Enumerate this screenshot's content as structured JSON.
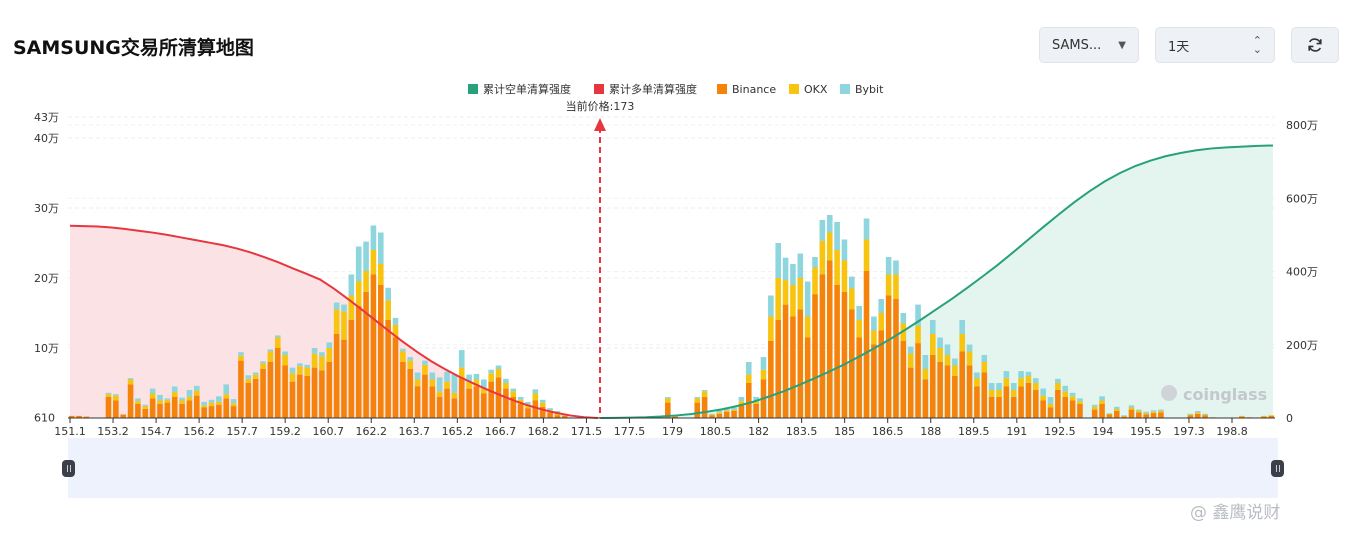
{
  "page": {
    "title": "SAMSUNG交易所清算地图",
    "symbol_select": "SAMS...",
    "range_select": "1天",
    "watermark_logo": "coinglass",
    "watermark_credit": "@ 鑫鹰说财"
  },
  "colors": {
    "short_cum": "#26a17b",
    "long_cum": "#e8363f",
    "binance": "#f5820a",
    "okx": "#f7c510",
    "bybit": "#8dd6dd",
    "long_fill": "#fbe3e5",
    "short_fill": "#e4f5ef"
  },
  "chart_data": {
    "type": "bar",
    "current_price_label": "当前价格:173",
    "current_price": 173,
    "legend": [
      "累计空单清算强度",
      "累计多单清算强度",
      "Binance",
      "OKX",
      "Bybit"
    ],
    "x_tick_labels": [
      "151.1",
      "153.2",
      "154.7",
      "156.2",
      "157.7",
      "159.2",
      "160.7",
      "162.2",
      "163.7",
      "165.2",
      "166.7",
      "168.2",
      "171.5",
      "177.5",
      "179",
      "180.5",
      "182",
      "183.5",
      "185",
      "186.5",
      "188",
      "189.5",
      "191",
      "192.5",
      "194",
      "195.5",
      "197.3",
      "198.8"
    ],
    "y_left_ticks": [
      {
        "value": 610,
        "label": "610"
      },
      {
        "value": 100000,
        "label": "10万"
      },
      {
        "value": 200000,
        "label": "20万"
      },
      {
        "value": 300000,
        "label": "30万"
      },
      {
        "value": 400000,
        "label": "40万"
      },
      {
        "value": 430000,
        "label": "43万"
      }
    ],
    "y_right_ticks": [
      {
        "value": 0,
        "label": "0"
      },
      {
        "value": 2000000,
        "label": "200万"
      },
      {
        "value": 4000000,
        "label": "400万"
      },
      {
        "value": 6000000,
        "label": "600万"
      },
      {
        "value": 8000000,
        "label": "800万"
      }
    ],
    "ylim_left": [
      0,
      430000
    ],
    "ylim_right": [
      0,
      8000000
    ],
    "bars_binance": [
      3000,
      3000,
      2000,
      0,
      0,
      30000,
      25000,
      5000,
      48000,
      20000,
      13000,
      28000,
      20000,
      22000,
      30000,
      20000,
      25000,
      32000,
      15000,
      17000,
      19000,
      28000,
      17000,
      82000,
      50000,
      56000,
      70000,
      80000,
      100000,
      75000,
      52000,
      62000,
      60000,
      72000,
      68000,
      80000,
      120000,
      112000,
      140000,
      160000,
      180000,
      205000,
      190000,
      140000,
      115000,
      80000,
      70000,
      45000,
      62000,
      45000,
      30000,
      42000,
      28000,
      58000,
      42000,
      45000,
      35000,
      52000,
      58000,
      42000,
      30000,
      20000,
      14000,
      25000,
      16000,
      8000,
      4000,
      3000,
      0,
      0,
      0,
      0,
      0,
      0,
      0,
      0,
      0,
      0,
      0,
      0,
      0,
      22000,
      2000,
      0,
      0,
      22000,
      30000,
      4000,
      6000,
      9000,
      10000,
      20000,
      50000,
      20000,
      55000,
      110000,
      140000,
      162000,
      145000,
      155000,
      115000,
      177000,
      205000,
      225000,
      190000,
      180000,
      155000,
      115000,
      210000,
      105000,
      125000,
      175000,
      170000,
      110000,
      72000,
      107000,
      55000,
      90000,
      80000,
      75000,
      60000,
      95000,
      75000,
      45000,
      65000,
      30000,
      30000,
      45000,
      30000,
      45000,
      50000,
      40000,
      25000,
      15000,
      40000,
      30000,
      25000,
      20000,
      0,
      12000,
      20000,
      5000,
      10000,
      2000,
      12000,
      8000,
      5000,
      7000,
      8000,
      0,
      0,
      0,
      4000,
      6000,
      4000,
      1000,
      0,
      0,
      0,
      2000,
      1000,
      0,
      2000,
      3000
    ],
    "bars_okx": [
      0,
      0,
      0,
      0,
      0,
      4000,
      7000,
      0,
      7000,
      4000,
      4000,
      7000,
      5000,
      4000,
      7000,
      5000,
      5000,
      7000,
      3000,
      5000,
      4000,
      6000,
      4000,
      7000,
      6000,
      6000,
      8000,
      15000,
      15000,
      15000,
      12000,
      12000,
      12000,
      20000,
      20000,
      20000,
      35000,
      40000,
      35000,
      35000,
      30000,
      35000,
      30000,
      28000,
      18000,
      15000,
      12000,
      10000,
      14000,
      10000,
      8000,
      10000,
      8000,
      14000,
      10000,
      10000,
      8000,
      12000,
      12000,
      8000,
      8000,
      6000,
      5000,
      10000,
      6000,
      3000,
      2000,
      1000,
      0,
      0,
      0,
      0,
      0,
      0,
      0,
      0,
      0,
      0,
      0,
      0,
      0,
      6000,
      1000,
      0,
      0,
      6000,
      8000,
      1000,
      2000,
      2000,
      2000,
      4000,
      12000,
      4000,
      14000,
      35000,
      60000,
      35000,
      45000,
      45000,
      30000,
      38000,
      48000,
      40000,
      50000,
      45000,
      30000,
      25000,
      45000,
      20000,
      25000,
      30000,
      35000,
      25000,
      20000,
      25000,
      15000,
      30000,
      20000,
      15000,
      15000,
      25000,
      20000,
      12000,
      15000,
      10000,
      10000,
      12000,
      10000,
      12000,
      10000,
      10000,
      7000,
      5000,
      10000,
      8000,
      6000,
      4000,
      0,
      4000,
      5000,
      1000,
      3000,
      1000,
      3000,
      2000,
      2000,
      2000,
      2000,
      0,
      0,
      0,
      1000,
      2000,
      1000,
      0,
      0,
      0,
      0,
      1000,
      0,
      0,
      1000,
      1000
    ],
    "bars_bybit": [
      0,
      0,
      0,
      0,
      0,
      2000,
      2000,
      0,
      2000,
      4000,
      2000,
      7000,
      8000,
      2000,
      8000,
      4000,
      10000,
      7000,
      5000,
      4000,
      8000,
      14000,
      6000,
      5000,
      5000,
      3000,
      3000,
      3000,
      3000,
      5000,
      8000,
      4000,
      4000,
      8000,
      6000,
      8000,
      10000,
      10000,
      30000,
      50000,
      42000,
      35000,
      45000,
      18000,
      10000,
      4000,
      5000,
      10000,
      6000,
      10000,
      20000,
      14000,
      26000,
      25000,
      10000,
      8000,
      12000,
      5000,
      5000,
      6000,
      4000,
      4000,
      4000,
      6000,
      4000,
      3000,
      4000,
      2000,
      0,
      0,
      0,
      0,
      0,
      0,
      0,
      0,
      0,
      0,
      0,
      0,
      0,
      2000,
      1000,
      0,
      0,
      2000,
      2000,
      1000,
      3000,
      4000,
      3000,
      6000,
      18000,
      6000,
      18000,
      30000,
      50000,
      32000,
      30000,
      35000,
      50000,
      15000,
      30000,
      25000,
      40000,
      30000,
      17000,
      20000,
      30000,
      20000,
      20000,
      25000,
      20000,
      15000,
      10000,
      30000,
      20000,
      20000,
      15000,
      15000,
      10000,
      20000,
      10000,
      8000,
      10000,
      10000,
      10000,
      10000,
      10000,
      10000,
      6000,
      7000,
      10000,
      10000,
      6000,
      8000,
      5000,
      4000,
      0,
      3000,
      6000,
      1000,
      3000,
      1000,
      3000,
      2000,
      2000,
      2000,
      2000,
      0,
      0,
      0,
      1000,
      2000,
      1000,
      0,
      0,
      0,
      0,
      0,
      0,
      0,
      0,
      0
    ],
    "long_cumulative": [
      5250000,
      5240000,
      5230000,
      5200000,
      5160000,
      5110000,
      5060000,
      5000000,
      4930000,
      4860000,
      4790000,
      4720000,
      4630000,
      4520000,
      4390000,
      4250000,
      4090000,
      3940000,
      3780000,
      3530000,
      3250000,
      2960000,
      2660000,
      2360000,
      2070000,
      1800000,
      1550000,
      1330000,
      1130000,
      950000,
      780000,
      620000,
      470000,
      340000,
      230000,
      140000,
      70000,
      20000,
      0
    ],
    "short_cumulative": [
      0,
      4000,
      10000,
      20000,
      40000,
      70000,
      110000,
      170000,
      240000,
      330000,
      440000,
      580000,
      730000,
      900000,
      1080000,
      1270000,
      1470000,
      1690000,
      1920000,
      2160000,
      2420000,
      2690000,
      2970000,
      3250000,
      3550000,
      3860000,
      4180000,
      4520000,
      4870000,
      5220000,
      5560000,
      5890000,
      6190000,
      6460000,
      6690000,
      6880000,
      7030000,
      7150000,
      7240000,
      7310000,
      7360000,
      7390000,
      7410000,
      7430000,
      7440000
    ]
  }
}
